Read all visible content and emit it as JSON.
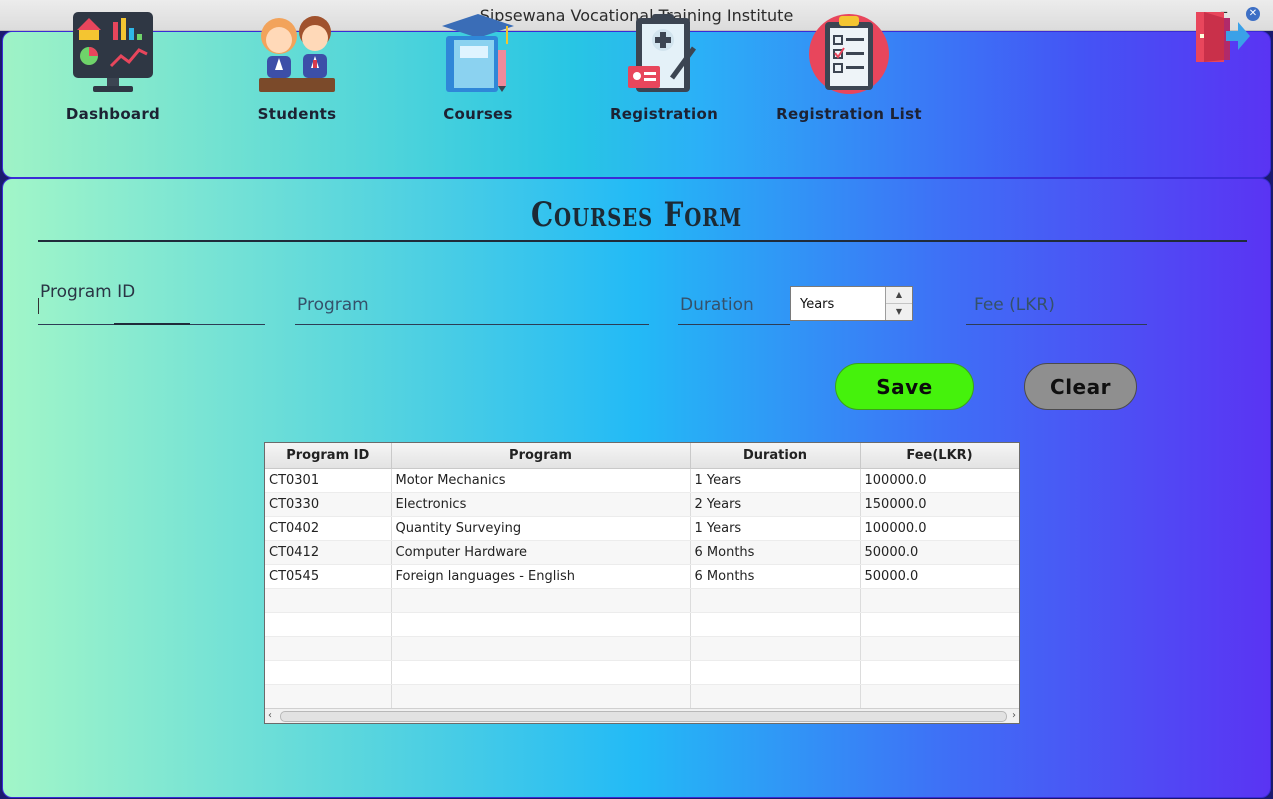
{
  "window": {
    "title": "Sipsewana Vocational Training Institute",
    "minimize_glyph": "–",
    "close_glyph": "✕"
  },
  "nav": {
    "items": [
      {
        "label": "Dashboard",
        "icon": "dashboard-monitor-icon"
      },
      {
        "label": "Students",
        "icon": "students-icon"
      },
      {
        "label": "Courses",
        "icon": "courses-book-icon"
      },
      {
        "label": "Registration",
        "icon": "registration-clipboard-icon"
      },
      {
        "label": "Registration List",
        "icon": "registration-list-icon"
      }
    ],
    "logout_icon": "logout-icon"
  },
  "form": {
    "title": "Courses Form",
    "fields": {
      "program_id": {
        "label": "Program ID",
        "value": ""
      },
      "program": {
        "label": "Program",
        "value": ""
      },
      "duration": {
        "label": "Duration",
        "unit_value": "Years"
      },
      "fee": {
        "label": "Fee (LKR)",
        "value": ""
      }
    },
    "buttons": {
      "save": "Save",
      "clear": "Clear"
    }
  },
  "table": {
    "columns": [
      "Program ID",
      "Program",
      "Duration",
      "Fee(LKR)"
    ],
    "rows": [
      [
        "CT0301",
        "Motor Mechanics",
        "1 Years",
        "100000.0"
      ],
      [
        "CT0330",
        "Electronics",
        "2 Years",
        "150000.0"
      ],
      [
        "CT0402",
        "Quantity Surveying",
        "1 Years",
        "100000.0"
      ],
      [
        "CT0412",
        "Computer Hardware",
        "6 Months",
        "50000.0"
      ],
      [
        "CT0545",
        "Foreign languages - English",
        "6 Months",
        "50000.0"
      ]
    ],
    "empty_rows": 5
  },
  "colors": {
    "save_button": "#45f20c",
    "clear_button": "#8f8f8f",
    "panel_gradient_start": "#a2f6c8",
    "panel_gradient_end": "#5a34f3"
  }
}
